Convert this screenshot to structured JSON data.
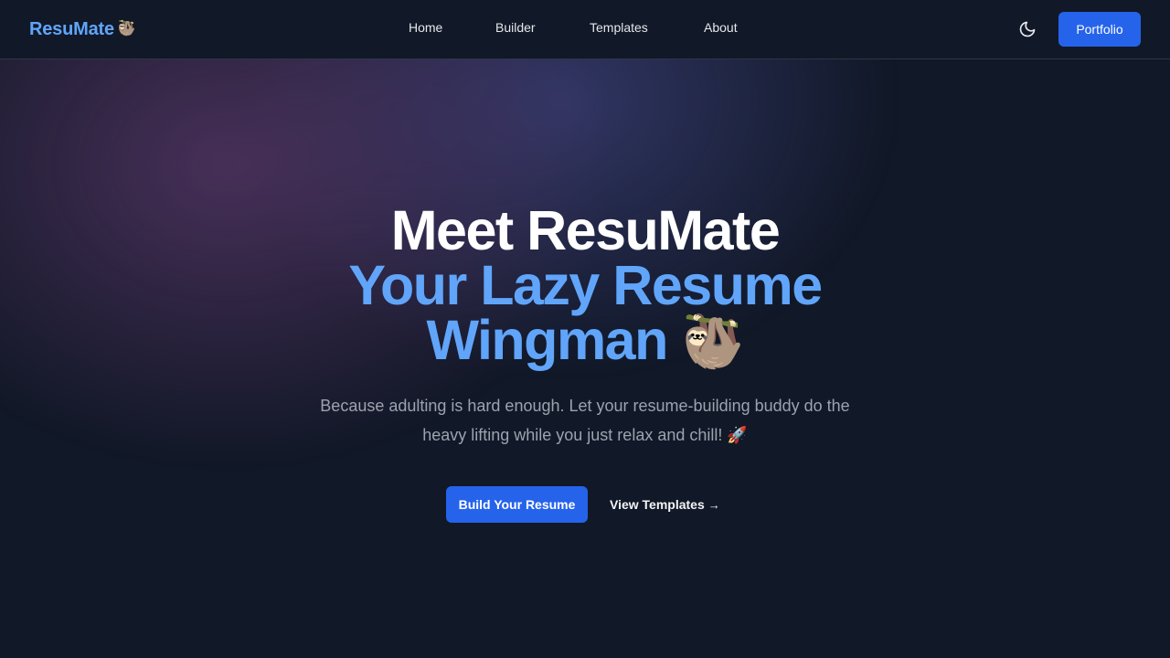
{
  "navbar": {
    "logo_text": "ResuMate",
    "logo_emoji": "🦥",
    "links": [
      {
        "label": "Home"
      },
      {
        "label": "Builder"
      },
      {
        "label": "Templates"
      },
      {
        "label": "About"
      }
    ],
    "theme_toggle_icon": "moon-icon",
    "portfolio_label": "Portfolio"
  },
  "hero": {
    "title_line1": "Meet ResuMate",
    "title_line2": "Your Lazy Resume",
    "title_line3": "Wingman",
    "title_emoji": "🦥",
    "subtitle_line1": "Because adulting is hard enough. Let your resume-building buddy do the",
    "subtitle_line2": "heavy lifting while you just relax and chill! 🚀",
    "primary_cta": "Build Your Resume",
    "secondary_cta": "View Templates",
    "secondary_cta_arrow": "→"
  },
  "colors": {
    "background": "#111827",
    "accent": "#2563eb",
    "brand_blue": "#60a5fa",
    "muted_text": "#9ca3af"
  }
}
